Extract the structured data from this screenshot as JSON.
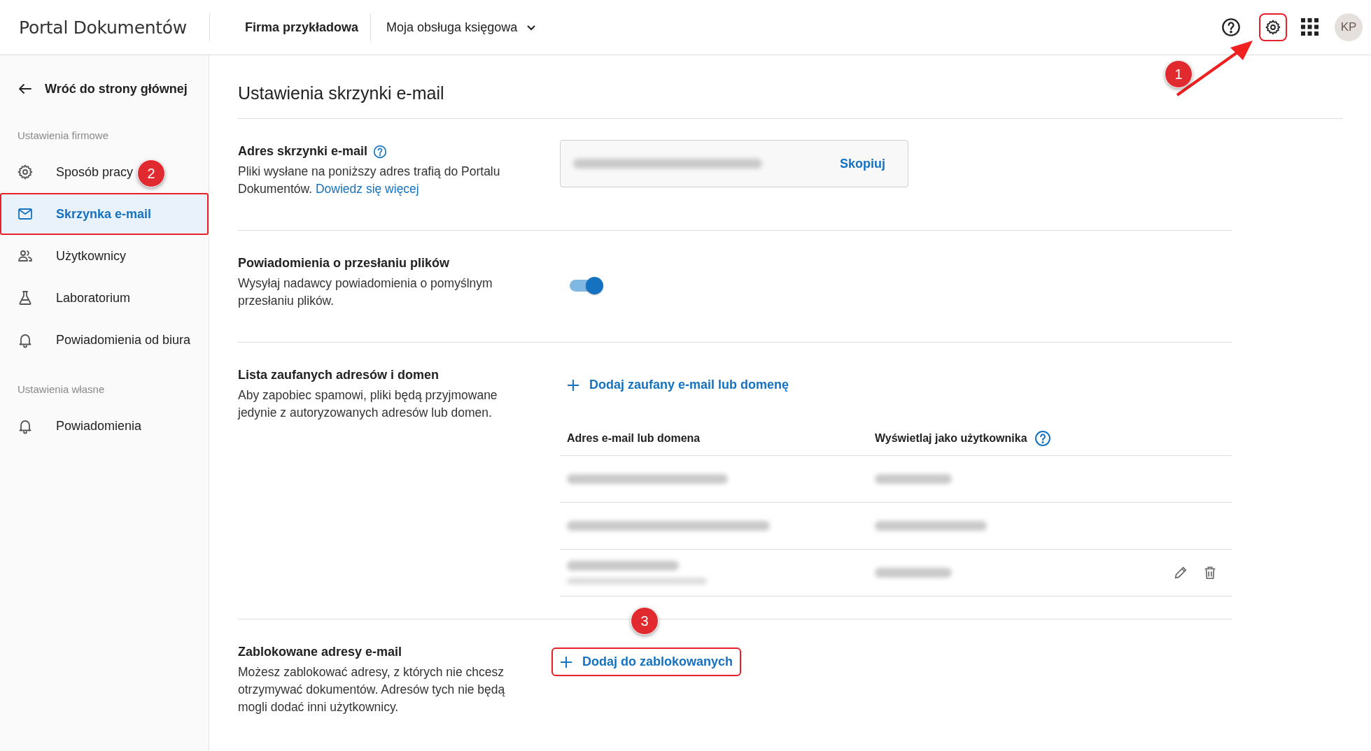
{
  "header": {
    "title": "Portal Dokumentów",
    "company": "Firma przykładowa",
    "service": "Moja obsługa księgowa",
    "avatar": "KP",
    "settings_highlighted": true
  },
  "sidebar": {
    "back": "Wróć do strony głównej",
    "groups": [
      {
        "title": "Ustawienia firmowe",
        "items": [
          {
            "label": "Sposób pracy",
            "selected": false,
            "highlighted": false
          },
          {
            "label": "Skrzynka e-mail",
            "selected": true,
            "highlighted": true
          },
          {
            "label": "Użytkownicy",
            "selected": false,
            "highlighted": false
          },
          {
            "label": "Laboratorium",
            "selected": false,
            "highlighted": false
          },
          {
            "label": "Powiadomienia od biura",
            "selected": false,
            "highlighted": false
          }
        ]
      },
      {
        "title": "Ustawienia własne",
        "items": [
          {
            "label": "Powiadomienia",
            "selected": false,
            "highlighted": false
          }
        ]
      }
    ]
  },
  "page": {
    "title": "Ustawienia skrzynki e-mail",
    "sections": [
      {
        "kind": "address",
        "heading": "Adres skrzynki e-mail",
        "description": "Pliki wysłane na poniższy adres trafią do Portalu Dokumentów.",
        "link": "Dowiedz się więcej",
        "copy_button": "Skopiuj"
      },
      {
        "kind": "toggle",
        "heading": "Powiadomienia o przesłaniu plików",
        "description": "Wysyłaj nadawcy powiadomienia o pomyślnym przesłaniu plików.",
        "on": true
      },
      {
        "kind": "trusted",
        "heading": "Lista zaufanych adresów i domen",
        "description": "Aby zapobiec spamowi, pliki będą przyjmowane jedynie z autoryzowanych adresów lub domen.",
        "add_button": "Dodaj zaufany e-mail lub domenę",
        "columns": [
          "Adres e-mail lub domena",
          "Wyświetlaj jako użytkownika"
        ],
        "rows": [
          {
            "hovered": false
          },
          {
            "hovered": false
          },
          {
            "hovered": true
          }
        ]
      },
      {
        "kind": "blocked",
        "heading": "Zablokowane adresy e-mail",
        "description": "Możesz zablokować adresy, z których nie chcesz otrzymywać dokumentów. Adresów tych nie będą mogli dodać inni użytkownicy.",
        "add_button": "Dodaj do zablokowanych",
        "highlighted": true
      }
    ]
  },
  "annotations": [
    {
      "number": "1"
    },
    {
      "number": "2"
    },
    {
      "number": "3"
    }
  ]
}
